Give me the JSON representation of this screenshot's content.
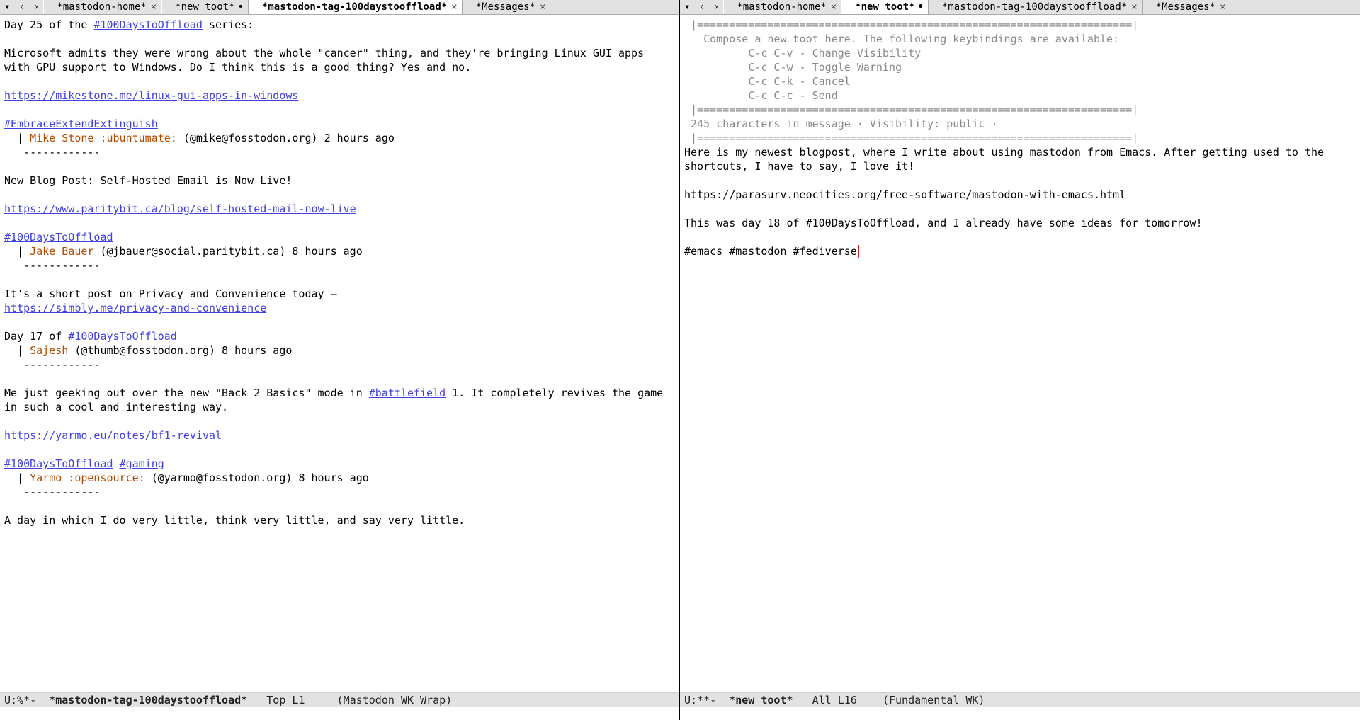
{
  "left": {
    "tabs": {
      "scroll_left": "‹",
      "scroll_right": "›",
      "items": [
        {
          "label": "*mastodon-home*",
          "modified": false,
          "close": "×",
          "active": false
        },
        {
          "label": "*new toot*",
          "modified": true,
          "close": "",
          "active": false
        },
        {
          "label": "*mastodon-tag-100daystooffload*",
          "modified": false,
          "close": "×",
          "active": true
        },
        {
          "label": "*Messages*",
          "modified": false,
          "close": "×",
          "active": false
        }
      ]
    },
    "posts": [
      {
        "lines": [
          [
            {
              "t": "text",
              "v": "Day 25 of the "
            },
            {
              "t": "hashtag",
              "v": "#100DaysToOffload"
            },
            {
              "t": "text",
              "v": " series:"
            }
          ],
          [],
          [
            {
              "t": "text",
              "v": "Microsoft admits they were wrong about the whole \"cancer\" thing, and they're bringing Linux GUI apps with GPU support to Windows. Do I think this is a good thing? Yes and no."
            }
          ],
          [],
          [
            {
              "t": "link",
              "v": "https://mikestone.me/linux-gui-apps-in-windows"
            }
          ],
          [],
          [
            {
              "t": "hashtag",
              "v": "#EmbraceExtendExtinguish"
            }
          ]
        ],
        "author_name": "Mike Stone :ubuntumate:",
        "author_handle": "(@mike@fosstodon.org)",
        "timestamp": "2 hours ago"
      },
      {
        "lines": [
          [
            {
              "t": "text",
              "v": "New Blog Post: Self-Hosted Email is Now Live!"
            }
          ],
          [],
          [
            {
              "t": "link",
              "v": "https://www.paritybit.ca/blog/self-hosted-mail-now-live"
            }
          ],
          [],
          [
            {
              "t": "hashtag",
              "v": "#100DaysToOffload"
            }
          ]
        ],
        "author_name": "Jake Bauer",
        "author_handle": "(@jbauer@social.paritybit.ca)",
        "timestamp": "8 hours ago"
      },
      {
        "lines": [
          [
            {
              "t": "text",
              "v": "It's a short post on Privacy and Convenience today —"
            }
          ],
          [
            {
              "t": "link",
              "v": "https://simbly.me/privacy-and-convenience"
            }
          ],
          [],
          [
            {
              "t": "text",
              "v": "Day 17 of "
            },
            {
              "t": "hashtag",
              "v": "#100DaysToOffload"
            }
          ]
        ],
        "author_name": "Sajesh",
        "author_handle": "(@thumb@fosstodon.org)",
        "timestamp": "8 hours ago"
      },
      {
        "lines": [
          [
            {
              "t": "text",
              "v": "Me just geeking out over the new \"Back 2 Basics\" mode in "
            },
            {
              "t": "hashtag",
              "v": "#battlefield"
            },
            {
              "t": "text",
              "v": " 1. It completely revives the game in such a cool and interesting way."
            }
          ],
          [],
          [
            {
              "t": "link",
              "v": "https://yarmo.eu/notes/bf1-revival"
            }
          ],
          [],
          [
            {
              "t": "hashtag",
              "v": "#100DaysToOffload"
            },
            {
              "t": "text",
              "v": " "
            },
            {
              "t": "hashtag",
              "v": "#gaming"
            }
          ]
        ],
        "author_name": "Yarmo :opensource:",
        "author_handle": "(@yarmo@fosstodon.org)",
        "timestamp": "8 hours ago"
      },
      {
        "lines": [
          [
            {
              "t": "text",
              "v": "A day in which I do very little, think very little, and say very little."
            }
          ]
        ]
      }
    ],
    "separator": "   ------------",
    "modeline": {
      "prefix": "U:%*-  ",
      "buffer": "*mastodon-tag-100daystooffload*",
      "pos": "   Top L1     ",
      "modes": "(Mastodon WK Wrap)"
    }
  },
  "right": {
    "tabs": {
      "scroll_left": "‹",
      "scroll_right": "›",
      "items": [
        {
          "label": "*mastodon-home*",
          "modified": false,
          "close": "×",
          "active": false
        },
        {
          "label": "*new toot*",
          "modified": true,
          "close": "",
          "active": true
        },
        {
          "label": "*mastodon-tag-100daystooffload*",
          "modified": false,
          "close": "×",
          "active": false
        },
        {
          "label": "*Messages*",
          "modified": false,
          "close": "×",
          "active": false
        }
      ]
    },
    "rule": " |====================================================================|",
    "hint_header": "   Compose a new toot here. The following keybindings are available:",
    "keybindings": [
      "          C-c C-v - Change Visibility",
      "          C-c C-w - Toggle Warning",
      "          C-c C-k - Cancel",
      "          C-c C-c - Send"
    ],
    "status_line": " 245 characters in message · Visibility: public ·",
    "compose_lines": [
      "Here is my newest blogpost, where I write about using mastodon from Emacs. After getting used to the shortcuts, I have to say, I love it!",
      "",
      "https://parasurv.neocities.org/free-software/mastodon-with-emacs.html",
      "",
      "This was day 18 of #100DaysToOffload, and I already have some ideas for tomorrow!",
      "",
      "#emacs #mastodon #fediverse"
    ],
    "modeline": {
      "prefix": "U:**-  ",
      "buffer": "*new toot*",
      "pos": "   All L16    ",
      "modes": "(Fundamental WK)"
    }
  }
}
